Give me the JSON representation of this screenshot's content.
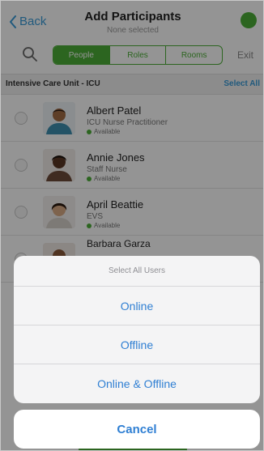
{
  "nav": {
    "back_label": "Back",
    "title": "Add Participants",
    "subtitle": "None selected",
    "status_color": "#4caf37"
  },
  "segments": {
    "items": [
      "People",
      "Roles",
      "Rooms"
    ],
    "selected": "People",
    "exit_label": "Exit"
  },
  "section": {
    "title": "Intensive Care Unit - ICU",
    "select_all_label": "Select All"
  },
  "participants": [
    {
      "name": "Albert Patel",
      "role": "ICU Nurse Practitioner",
      "status": "Available"
    },
    {
      "name": "Annie Jones",
      "role": "Staff Nurse",
      "status": "Available"
    },
    {
      "name": "April Beattie",
      "role": "EVS",
      "status": "Available"
    },
    {
      "name": "Barbara Garza"
    }
  ],
  "action_sheet": {
    "title": "Select All Users",
    "options": [
      "Online",
      "Offline",
      "Online & Offline"
    ],
    "cancel_label": "Cancel"
  },
  "colors": {
    "accent_green": "#4caf37",
    "link_blue": "#2f7fd3"
  }
}
